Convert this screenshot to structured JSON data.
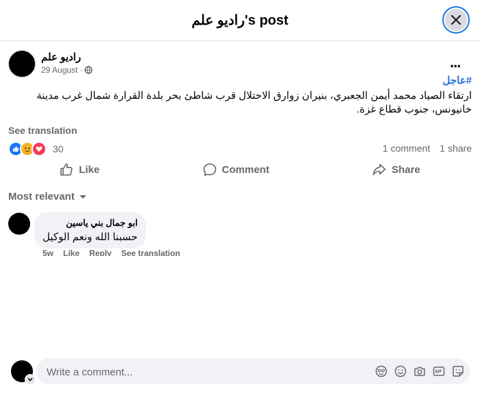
{
  "header": {
    "title": "راديو علم's post"
  },
  "post": {
    "author": "راديو علم",
    "date": "29 August",
    "privacy_separator": "·",
    "hashtag": "#عاجل",
    "text": "ارتقاء الصياد محمد أيمن الجعبري، بنيران زوارق الاحتلال قرب شاطئ بحر بلدة القرارة شمال غرب مدينة خانيونس، جنوب قطاع غزة.",
    "see_translation": "See translation",
    "reaction_count": "30",
    "comments_count": "1 comment",
    "shares_count": "1 share",
    "actions": {
      "like": "Like",
      "comment": "Comment",
      "share": "Share"
    },
    "more_label": "..."
  },
  "comments": {
    "sort_label": "Most relevant",
    "items": [
      {
        "author": "ابو جمال بني ياسين",
        "text": "حسبنا الله ونعم الوكيل",
        "time": "5w",
        "like": "Like",
        "reply": "Reply",
        "see_translation": "See translation"
      }
    ]
  },
  "composer": {
    "placeholder": "Write a comment..."
  },
  "colors": {
    "accent": "#1b74e4",
    "link": "#216fdb",
    "muted": "#65676b",
    "bubble": "#f0f2f5"
  },
  "icons": [
    "close-icon",
    "globe-icon",
    "more-icon",
    "like-reaction-icon",
    "sad-reaction-icon",
    "love-reaction-icon",
    "thumb-up-icon",
    "comment-icon",
    "share-icon",
    "caret-down-icon",
    "avatar-sticker-icon",
    "emoji-icon",
    "camera-icon",
    "gif-icon",
    "sticker-icon"
  ]
}
